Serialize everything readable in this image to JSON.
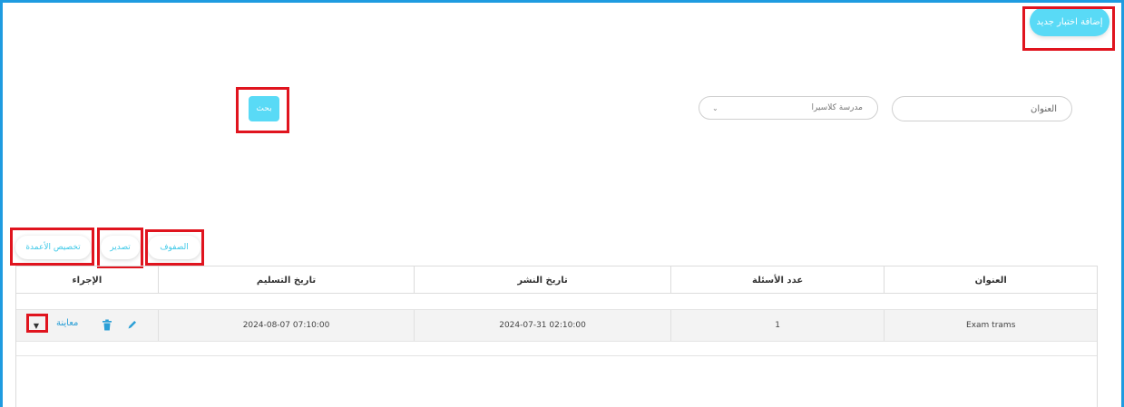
{
  "header": {
    "add_button_label": "إضافة اختبار جديد"
  },
  "filters": {
    "title_placeholder": "العنوان",
    "school_selected": "مدرسة كلاسيرا",
    "search_button_label": "بحث"
  },
  "toolbar": {
    "rows_label": "الصفوف",
    "export_label": "تصدير",
    "customize_columns_label": "تخصيص الأعمدة"
  },
  "table": {
    "columns": {
      "title": "العنوان",
      "question_count": "عدد الأسئلة",
      "publish_date": "تاريخ النشر",
      "delivery_date": "تاريخ التسليم",
      "action": "الإجراء"
    },
    "rows": [
      {
        "title": "Exam trams",
        "question_count": "1",
        "publish_date": "2024-07-31 02:10:00",
        "delivery_date": "2024-08-07 07:10:00",
        "preview_label": "معاينة"
      }
    ]
  },
  "colors": {
    "accent": "#59daf6",
    "link": "#2b9fd6",
    "frame": "#1e9be0",
    "highlight": "#e0141e"
  }
}
